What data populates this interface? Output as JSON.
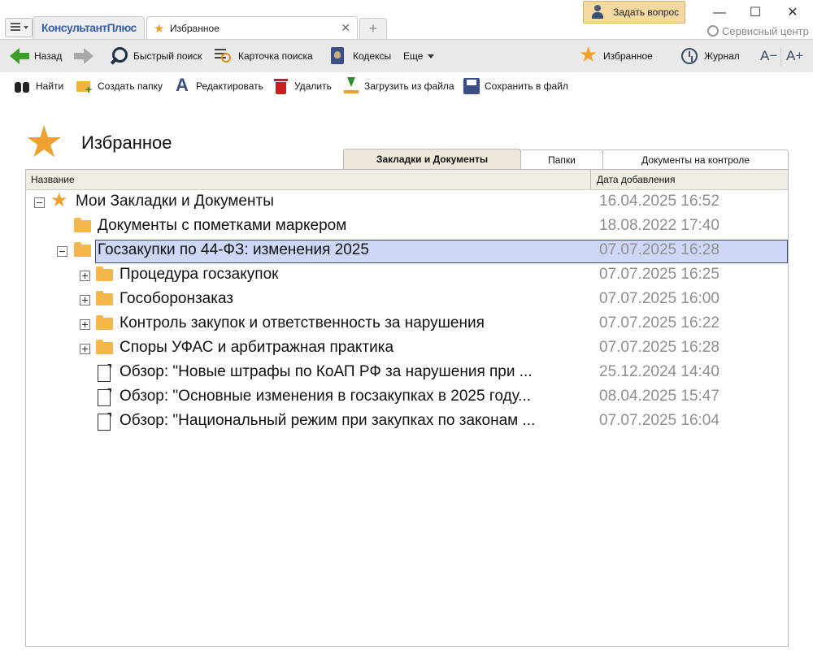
{
  "window": {
    "logo_text": "КонсультантПлюс",
    "tab_label": "Избранное",
    "ask_question": "Задать вопрос",
    "service_center": "Сервисный центр",
    "min_glyph": "—",
    "max_glyph": "☐",
    "close_glyph": "✕",
    "tab_close_glyph": "✕",
    "new_tab_glyph": "+"
  },
  "toolbar": {
    "back": "Назад",
    "quick_search": "Быстрый поиск",
    "search_card": "Карточка поиска",
    "codexes": "Кодексы",
    "more": "Еще",
    "favorites": "Избранное",
    "journal": "Журнал",
    "font_smaller": "A−",
    "font_larger": "A+"
  },
  "actions": {
    "find": "Найти",
    "create_folder": "Создать папку",
    "edit": "Редактировать",
    "delete": "Удалить",
    "load_from_file": "Загрузить из файла",
    "save_to_file": "Сохранить в файл"
  },
  "page": {
    "title": "Избранное",
    "tabs": [
      {
        "label": "Закладки и Документы",
        "active": true
      },
      {
        "label": "Папки",
        "active": false
      },
      {
        "label": "Документы на контроле",
        "active": false
      }
    ]
  },
  "table": {
    "columns": [
      "Название",
      "Дата добавления"
    ],
    "rows": [
      {
        "type": "root",
        "toggle": "minus",
        "name": "Мои Закладки и Документы",
        "date": "16.04.2025 16:52"
      },
      {
        "type": "folder",
        "toggle": "none",
        "name": "Документы с пометками маркером",
        "date": "18.08.2022 17:40"
      },
      {
        "type": "folder",
        "toggle": "minus",
        "name": "Госзакупки по 44-ФЗ: изменения 2025",
        "date": "07.07.2025 16:28",
        "selected": true
      },
      {
        "type": "folder",
        "toggle": "plus",
        "name": "Процедура госзакупок",
        "date": "07.07.2025 16:25"
      },
      {
        "type": "folder",
        "toggle": "plus",
        "name": "Гособоронзаказ",
        "date": "07.07.2025 16:00"
      },
      {
        "type": "folder",
        "toggle": "plus",
        "name": "Контроль закупок и ответственность за нарушения",
        "date": "07.07.2025 16:22"
      },
      {
        "type": "folder",
        "toggle": "plus",
        "name": "Споры УФАС и арбитражная практика",
        "date": "07.07.2025 16:28"
      },
      {
        "type": "document",
        "toggle": "none",
        "name": "Обзор: \"Новые штрафы по КоАП РФ за нарушения при ...",
        "date": "25.12.2024 14:40"
      },
      {
        "type": "document",
        "toggle": "none",
        "name": "Обзор: \"Основные изменения в госзакупках в 2025 году...",
        "date": "08.04.2025 15:47"
      },
      {
        "type": "document",
        "toggle": "none",
        "name": "Обзор: \"Национальный режим при закупках по законам ...",
        "date": "07.07.2025 16:04"
      }
    ]
  },
  "colors": {
    "accent_star": "#f0a230",
    "selection_bg": "#cfd7f7",
    "selection_border": "#3b4f86",
    "date_text": "#8f8f8f"
  }
}
